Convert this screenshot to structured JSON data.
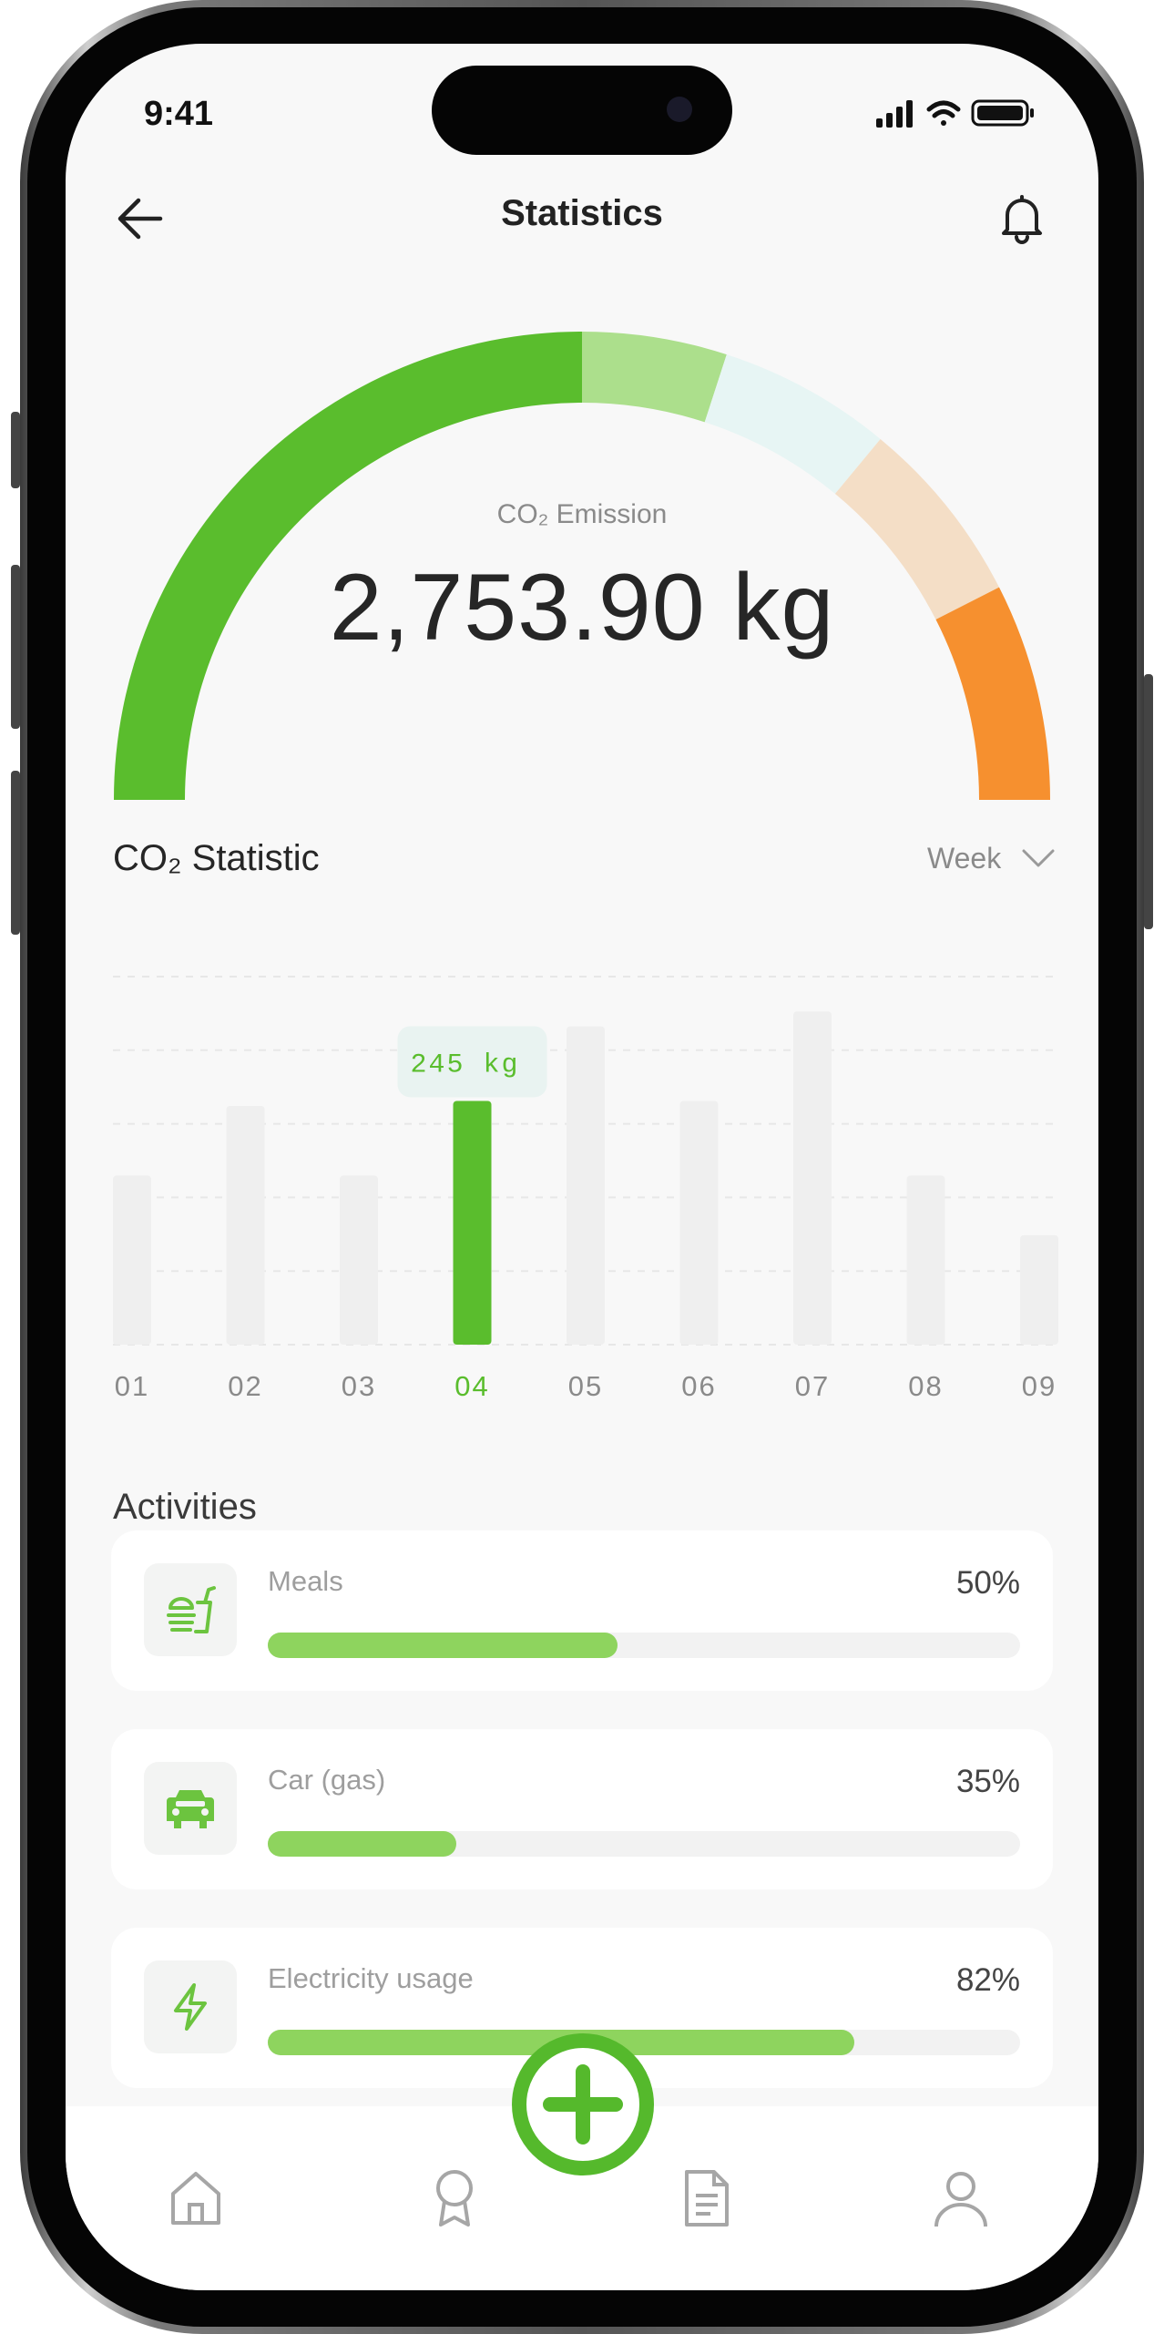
{
  "status_bar": {
    "time": "9:41"
  },
  "header": {
    "title": "Statistics",
    "back_icon": "arrow-left-icon",
    "bell_icon": "bell-icon"
  },
  "gauge": {
    "label": "CO₂ Emission",
    "value": "2,753.90 kg",
    "segments": [
      {
        "share": 0.5,
        "color": "#5abd2d"
      },
      {
        "share": 0.1,
        "color": "#acdf8c"
      },
      {
        "share": 0.12,
        "color": "#e7f5f4"
      },
      {
        "share": 0.13,
        "color": "#f4dec6"
      },
      {
        "share": 0.15,
        "color": "#f6902f"
      }
    ]
  },
  "statistic": {
    "title": "CO₂ Statistic",
    "period": "Week"
  },
  "chart_data": {
    "type": "bar",
    "categories": [
      "01",
      "02",
      "03",
      "04",
      "05",
      "06",
      "07",
      "08",
      "09"
    ],
    "values": [
      170,
      240,
      170,
      245,
      320,
      245,
      335,
      170,
      110
    ],
    "highlighted_index": 3,
    "highlight_label": "245 kg",
    "ylim": [
      0,
      370
    ],
    "grid": true,
    "bar_color": "#efefef",
    "highlight_color": "#5abd2d"
  },
  "activities": {
    "title": "Activities",
    "items": [
      {
        "name": "Meals",
        "percent": "50%",
        "fill": 0.465,
        "icon": "meal-icon"
      },
      {
        "name": "Car (gas)",
        "percent": "35%",
        "fill": 0.25,
        "icon": "car-icon"
      },
      {
        "name": "Electricity usage",
        "percent": "82%",
        "fill": 0.78,
        "icon": "lightning-icon"
      }
    ]
  },
  "tabbar": {
    "items": [
      {
        "icon": "home-icon"
      },
      {
        "icon": "award-icon"
      },
      {
        "icon": "document-icon"
      },
      {
        "icon": "profile-icon"
      }
    ],
    "fab_icon": "plus-icon"
  }
}
